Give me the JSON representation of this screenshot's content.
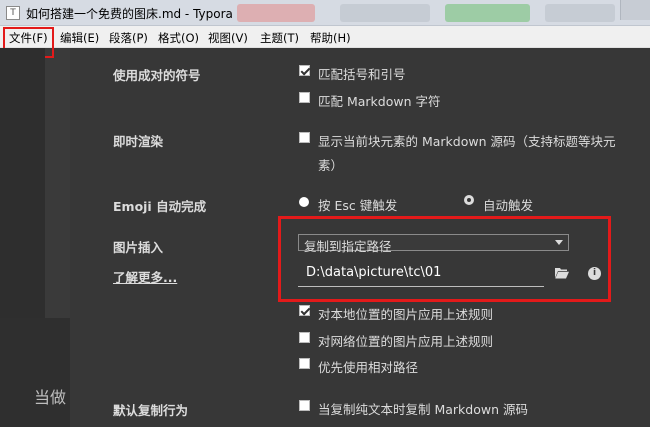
{
  "window": {
    "title": "如何搭建一个免费的图床.md - Typora",
    "app_icon_letter": "T"
  },
  "menu": [
    {
      "label": "文件(F)"
    },
    {
      "label": "编辑(E)"
    },
    {
      "label": "段落(P)"
    },
    {
      "label": "格式(O)"
    },
    {
      "label": "视图(V)"
    },
    {
      "label": "主题(T)"
    },
    {
      "label": "帮助(H)"
    }
  ],
  "background_text": "当做",
  "preferences": {
    "paired_symbols": {
      "label": "使用成对的符号",
      "options": [
        {
          "text": "匹配括号和引号",
          "checked": true
        },
        {
          "text": "匹配 Markdown 字符",
          "checked": false
        }
      ]
    },
    "instant_render": {
      "label": "即时渲染",
      "option_line1": "显示当前块元素的 Markdown 源码（支持标题等块元",
      "option_line2": "素）",
      "checked": false
    },
    "emoji": {
      "label": "Emoji 自动完成",
      "options": [
        {
          "text": "按 Esc 键触发",
          "selected": false
        },
        {
          "text": "自动触发",
          "selected": true
        }
      ]
    },
    "image_insert": {
      "label": "图片插入",
      "learn_more": "了解更多...",
      "select_value": "复制到指定路径",
      "path_value": "D:\\data\\picture\\tc\\01",
      "options": [
        {
          "text": "对本地位置的图片应用上述规则",
          "checked": true
        },
        {
          "text": "对网络位置的图片应用上述规则",
          "checked": false
        },
        {
          "text": "优先使用相对路径",
          "checked": false
        }
      ]
    },
    "default_copy": {
      "label": "默认复制行为",
      "option": "当复制纯文本时复制 Markdown 源码",
      "checked": false
    }
  },
  "icons": {
    "folder": "folder-open-icon",
    "info": "info-icon"
  },
  "colors": {
    "highlight": "#e31a1a",
    "panel_bg": "#373737",
    "text": "#dcdcdc"
  }
}
